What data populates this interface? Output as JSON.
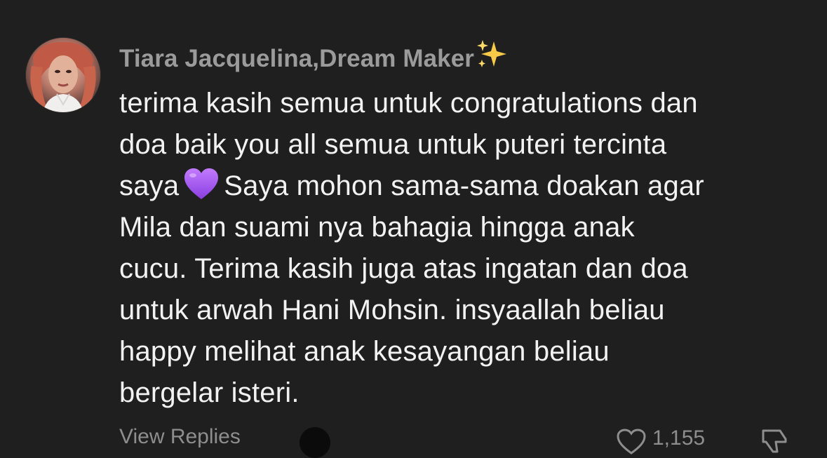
{
  "comment": {
    "username": "Tiara Jacquelina,Dream Maker",
    "username_emoji_icon": "sparkles-icon",
    "lines": {
      "l1": "terima kasih semua untuk congratulations dan",
      "l2": "doa baik you all semua untuk puteri tercinta",
      "l3a": "saya",
      "l3b": "Saya mohon sama-sama doakan agar",
      "l4": "Mila dan suami nya bahagia hingga anak",
      "l5": "cucu. Terima kasih juga atas ingatan dan doa",
      "l6": "untuk arwah Hani Mohsin. insyaallah beliau",
      "l7": "happy melihat anak kesayangan beliau",
      "l8": "bergelar isteri."
    },
    "inline_emoji_icon": "purple-heart-icon"
  },
  "footer": {
    "reply_label": "View Replies",
    "like_count": "1,155"
  },
  "colors": {
    "background": "#1f1f1f",
    "username": "#9b9b9b",
    "text": "#f2f2f2",
    "purple_heart": "#a45cf0",
    "sparkle": "#f7c948"
  }
}
